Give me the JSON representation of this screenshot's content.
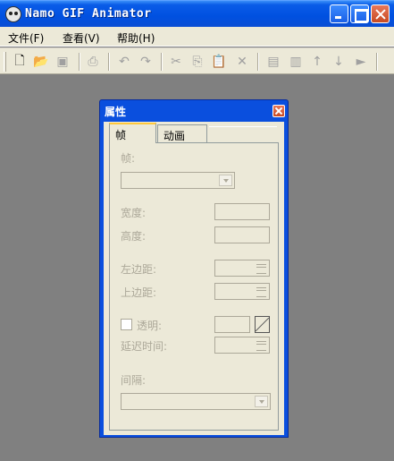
{
  "app": {
    "title": "Namo GIF Animator"
  },
  "menu": {
    "items": [
      "文件(F)",
      "查看(V)",
      "帮助(H)"
    ]
  },
  "toolbar": {
    "icons": [
      "new-file-icon",
      "open-folder-icon",
      "save-icon",
      "print-icon",
      "undo-icon",
      "redo-icon",
      "cut-icon",
      "copy-icon",
      "paste-icon",
      "delete-icon",
      "insert-frame-icon",
      "duplicate-frame-icon",
      "move-up-icon",
      "move-down-icon",
      "play-icon"
    ]
  },
  "panel": {
    "title": "属性",
    "tabs": [
      "帧",
      "动画"
    ],
    "frame_label": "帧:",
    "width_label": "宽度:",
    "height_label": "高度:",
    "left_margin_label": "左边距:",
    "top_margin_label": "上边距:",
    "transparent_label": "透明:",
    "delay_label": "延迟时间:",
    "interval_label": "间隔:"
  },
  "colors": {
    "titlebar": "#0a5ce8",
    "panel_border": "#0a4fde",
    "face": "#ece9d8",
    "disabled_text": "#aca899"
  }
}
